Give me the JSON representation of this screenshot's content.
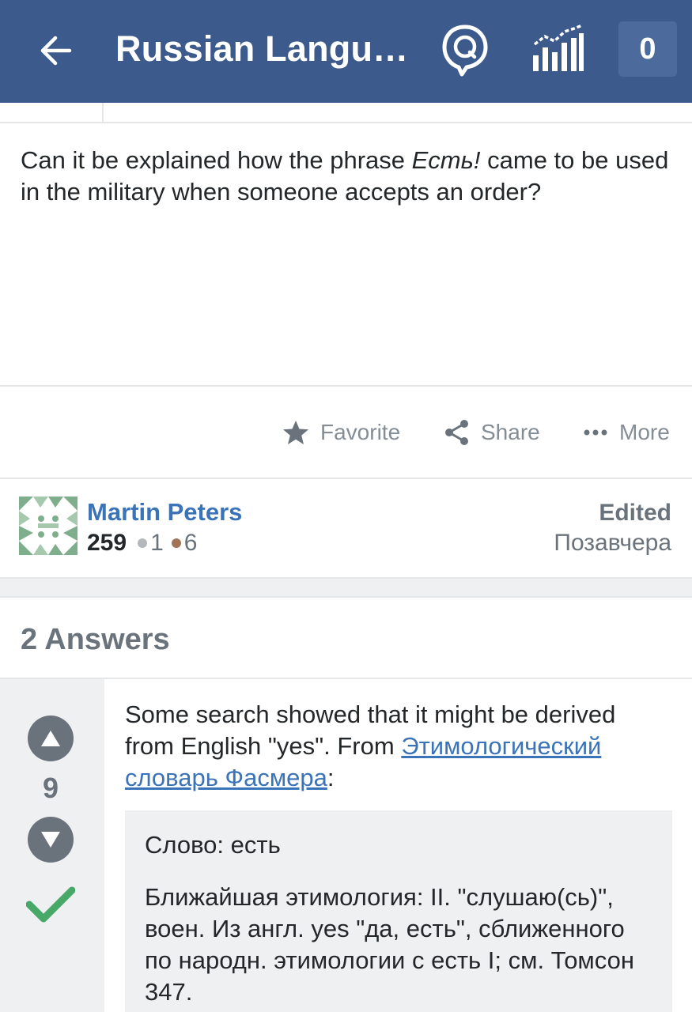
{
  "header": {
    "title": "Russian Langu…",
    "notification_count": "0",
    "icons": [
      "back-arrow-icon",
      "inbox-icon",
      "achievements-icon"
    ]
  },
  "question": {
    "text_before": "Can it be explained how the phrase ",
    "text_emph": "Есть!",
    "text_after": " came to be used in the military when someone accepts an order?"
  },
  "actions": {
    "favorite": "Favorite",
    "share": "Share",
    "more": "More"
  },
  "owner": {
    "name": "Martin Peters",
    "reputation": "259",
    "silver_badges": "1",
    "bronze_badges": "6",
    "edited_label": "Edited",
    "edited_when": "Позавчера"
  },
  "answers": {
    "heading": "2 Answers",
    "first": {
      "score": "9",
      "accepted": true,
      "text_before": "Some search showed that it might be derived from English \"yes\". From ",
      "link_text": "Этимологический словарь Фасмера",
      "text_after": ":",
      "quote_line1": "Слово: есть",
      "quote_line2": "Ближайшая этимология: II. \"слушаю(сь)\", воен. Из англ. yes \"да, есть\", сближенного по народн. этимологии с есть I; см. Томсон 347."
    }
  },
  "colors": {
    "appbar": "#3d5a8c",
    "link": "#3b73b9",
    "accepted": "#48a868",
    "muted": "#6a737c"
  }
}
